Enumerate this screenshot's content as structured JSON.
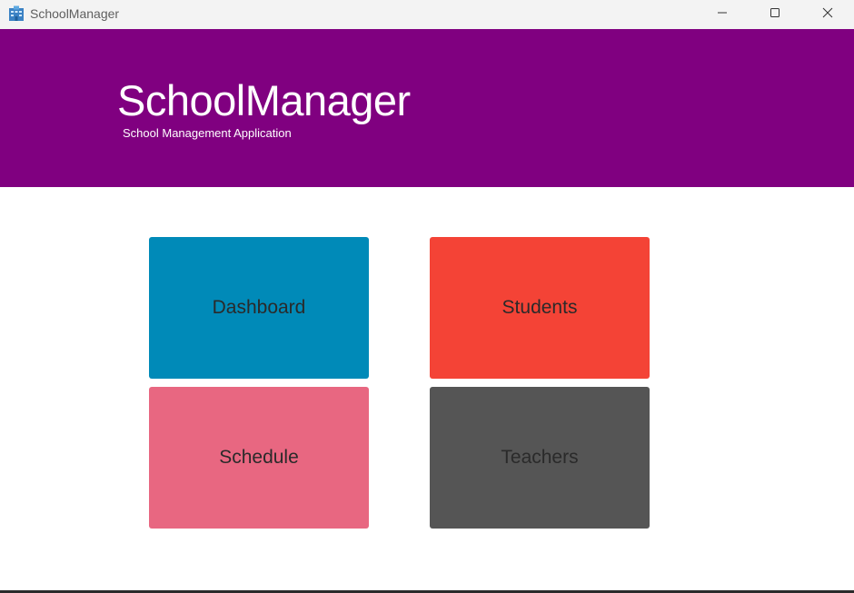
{
  "window": {
    "title": "SchoolManager",
    "icon": "building-icon",
    "controls": {
      "minimize_icon": "minimize-icon",
      "maximize_icon": "maximize-icon",
      "close_icon": "close-icon"
    }
  },
  "header": {
    "title": "SchoolManager",
    "subtitle": "School Management Application",
    "background": "#800080"
  },
  "tiles": [
    {
      "label": "Dashboard",
      "color": "#008ab8"
    },
    {
      "label": "Students",
      "color": "#f44336"
    },
    {
      "label": "Schedule",
      "color": "#e86781"
    },
    {
      "label": "Teachers",
      "color": "#555555"
    }
  ]
}
